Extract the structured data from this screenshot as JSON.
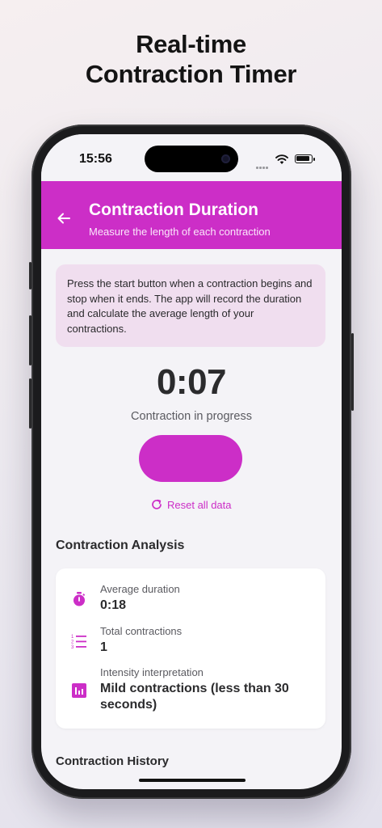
{
  "promo": {
    "line1": "Real-time",
    "line2": "Contraction Timer"
  },
  "status_bar": {
    "time": "15:56"
  },
  "header": {
    "title": "Contraction Duration",
    "subtitle": "Measure the length of each contraction",
    "back_icon": "arrow-left-icon"
  },
  "info_text": "Press the start button when a contraction begins and stop when it ends. The app will record the duration and calculate the average length of your contractions.",
  "timer": {
    "value": "0:07",
    "status": "Contraction in progress"
  },
  "reset": {
    "label": "Reset all data",
    "icon": "refresh-icon"
  },
  "analysis": {
    "title": "Contraction Analysis",
    "stats": [
      {
        "label": "Average duration",
        "value": "0:18",
        "icon": "stopwatch-icon"
      },
      {
        "label": "Total contractions",
        "value": "1",
        "icon": "numbered-list-icon"
      },
      {
        "label": "Intensity interpretation",
        "value": "Mild contractions (less than 30 seconds)",
        "icon": "bar-chart-icon"
      }
    ]
  },
  "history": {
    "title": "Contraction History"
  },
  "colors": {
    "accent": "#cc2ec7",
    "info_bg": "#f0deef",
    "screen_bg": "#f4f3f7"
  }
}
